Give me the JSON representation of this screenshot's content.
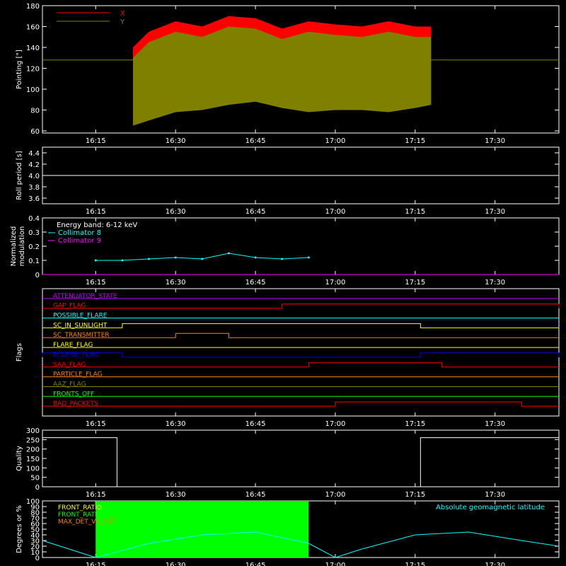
{
  "colors": {
    "axis": "#ffffff",
    "red": "#ff0000",
    "olive": "#808000",
    "cyan": "#00ffff",
    "magenta": "#ff00ff",
    "green": "#00ff00",
    "orange": "#ff8000",
    "yellow": "#ffff00",
    "blue": "#0000ff",
    "purple": "#c000ff"
  },
  "time_ticks": [
    "16:15",
    "16:30",
    "16:45",
    "17:00",
    "17:15",
    "17:30"
  ],
  "chart_data": [
    {
      "id": "pointing",
      "type": "area",
      "ylabel": "Pointing [\"]",
      "xlim": [
        "16:05",
        "17:42"
      ],
      "ylim": [
        58,
        180
      ],
      "yticks": [
        "60",
        "80",
        "100",
        "120",
        "140",
        "160",
        "180"
      ],
      "legend": [
        {
          "name": "X",
          "color": "#ff0000"
        },
        {
          "name": "Y",
          "color": "#808000"
        }
      ],
      "legend_position": "top-left",
      "baseline_value": 128,
      "series": [
        {
          "name": "X",
          "x": [
            "16:22",
            "16:25",
            "16:30",
            "16:35",
            "16:40",
            "16:45",
            "16:50",
            "16:55",
            "17:00",
            "17:05",
            "17:10",
            "17:15",
            "17:18"
          ],
          "upper": [
            140,
            155,
            165,
            160,
            170,
            168,
            158,
            165,
            162,
            160,
            165,
            160,
            160
          ],
          "lower": [
            128,
            128,
            128,
            128,
            128,
            128,
            128,
            128,
            128,
            128,
            128,
            128,
            128
          ]
        },
        {
          "name": "Y",
          "x": [
            "16:22",
            "16:25",
            "16:30",
            "16:35",
            "16:40",
            "16:45",
            "16:50",
            "16:55",
            "17:00",
            "17:05",
            "17:10",
            "17:15",
            "17:18"
          ],
          "upper": [
            130,
            145,
            155,
            150,
            160,
            158,
            148,
            155,
            152,
            150,
            155,
            150,
            150
          ],
          "lower": [
            65,
            70,
            78,
            80,
            85,
            88,
            82,
            78,
            80,
            80,
            78,
            82,
            85
          ]
        }
      ]
    },
    {
      "id": "roll",
      "type": "line",
      "ylabel": "Roll period [s]",
      "xlim": [
        "16:05",
        "17:42"
      ],
      "ylim": [
        3.5,
        4.5
      ],
      "yticks": [
        "3.6",
        "3.8",
        "4.0",
        "4.2",
        "4.4"
      ],
      "series": [
        {
          "name": "",
          "x": [
            "16:05",
            "17:42"
          ],
          "values": [
            4.0,
            4.0
          ]
        }
      ]
    },
    {
      "id": "modulation",
      "type": "line",
      "ylabel": "Normalized modulation",
      "xlim": [
        "16:05",
        "17:42"
      ],
      "ylim": [
        0,
        0.4
      ],
      "yticks": [
        "0",
        "0.1",
        "0.2",
        "0.3",
        "0.4"
      ],
      "annotation": "Energy band: 6-12 keV",
      "legend": [
        {
          "name": "Collimator 8",
          "color": "#00ffff"
        },
        {
          "name": "Collimator 9",
          "color": "#ff00ff"
        }
      ],
      "legend_position": "top-left",
      "series": [
        {
          "name": "Collimator 8",
          "x": [
            "16:15",
            "16:20",
            "16:25",
            "16:30",
            "16:35",
            "16:40",
            "16:45",
            "16:50",
            "16:55"
          ],
          "values": [
            0.1,
            0.1,
            0.11,
            0.12,
            0.11,
            0.15,
            0.12,
            0.11,
            0.12
          ]
        },
        {
          "name": "Collimator 9",
          "x": [
            "16:05",
            "17:42"
          ],
          "values": [
            0,
            0
          ]
        }
      ]
    },
    {
      "id": "flags",
      "type": "line",
      "ylabel": "Flags",
      "xlim": [
        "16:05",
        "17:42"
      ],
      "flags": [
        {
          "name": "ATTENUATOR_STATE",
          "color": "#c000ff",
          "segments": []
        },
        {
          "name": "GAP_FLAG",
          "color": "#ff0000",
          "segments": [
            [
              "16:50",
              "17:42"
            ]
          ]
        },
        {
          "name": "POSSIBLE_FLARE",
          "color": "#00ffff",
          "segments": []
        },
        {
          "name": "SC_IN_SUNLIGHT",
          "color": "#ffff00",
          "segments": [
            [
              "16:20",
              "17:16"
            ]
          ]
        },
        {
          "name": "SC_TRANSMITTER",
          "color": "#ff8000",
          "segments": [
            [
              "16:30",
              "16:40"
            ]
          ]
        },
        {
          "name": "FLARE_FLAG",
          "color": "#ffff00",
          "segments": []
        },
        {
          "name": "ECLIPSE_FLAG",
          "color": "#0000ff",
          "segments": [
            [
              "16:05",
              "16:20"
            ],
            [
              "17:16",
              "17:42"
            ]
          ]
        },
        {
          "name": "SAA_FLAG",
          "color": "#ff0000",
          "segments": [
            [
              "16:55",
              "17:20"
            ]
          ]
        },
        {
          "name": "PARTICLE_FLAG",
          "color": "#ff8000",
          "segments": []
        },
        {
          "name": "AAZ_FLAG",
          "color": "#808000",
          "segments": []
        },
        {
          "name": "FRONTS_OFF",
          "color": "#00ff00",
          "segments": []
        },
        {
          "name": "BAD_PACKETS",
          "color": "#ff0000",
          "segments": [
            [
              "17:00",
              "17:35"
            ]
          ]
        }
      ]
    },
    {
      "id": "quality",
      "type": "line",
      "ylabel": "Quality",
      "xlim": [
        "16:05",
        "17:42"
      ],
      "ylim": [
        0,
        300
      ],
      "yticks": [
        "0",
        "50",
        "100",
        "150",
        "200",
        "250",
        "300"
      ],
      "series": [
        {
          "name": "",
          "x": [
            "16:05",
            "16:19",
            "16:19",
            "17:16",
            "17:16",
            "17:42"
          ],
          "values": [
            260,
            260,
            0,
            0,
            260,
            260
          ]
        }
      ]
    },
    {
      "id": "latitude",
      "type": "line",
      "ylabel": "Degrees or %",
      "xlim": [
        "16:05",
        "17:42"
      ],
      "ylim": [
        0,
        100
      ],
      "yticks": [
        "0",
        "10",
        "20",
        "30",
        "40",
        "50",
        "60",
        "70",
        "80",
        "90",
        "100"
      ],
      "legend": [
        {
          "name": "FRONT_RATIO",
          "color": "#ffff00"
        },
        {
          "name": "FRONT_RATIO_",
          "color": "#00ff00"
        },
        {
          "name": "MAX_DET_VS_TOT",
          "color": "#ff8000"
        }
      ],
      "legend_position": "top-left",
      "annotation": "Absolute geomagnetic latitude",
      "series": [
        {
          "name": "Absolute geomagnetic latitude",
          "x": [
            "16:05",
            "16:10",
            "16:15",
            "16:25",
            "16:35",
            "16:45",
            "16:55",
            "17:00",
            "17:05",
            "17:15",
            "17:25",
            "17:35",
            "17:42"
          ],
          "values": [
            30,
            15,
            0,
            25,
            40,
            45,
            25,
            0,
            15,
            40,
            45,
            30,
            20
          ]
        },
        {
          "name": "FRONT_RATIO_",
          "x": [
            "16:15",
            "16:55"
          ],
          "values": [
            100,
            100
          ]
        }
      ]
    }
  ]
}
